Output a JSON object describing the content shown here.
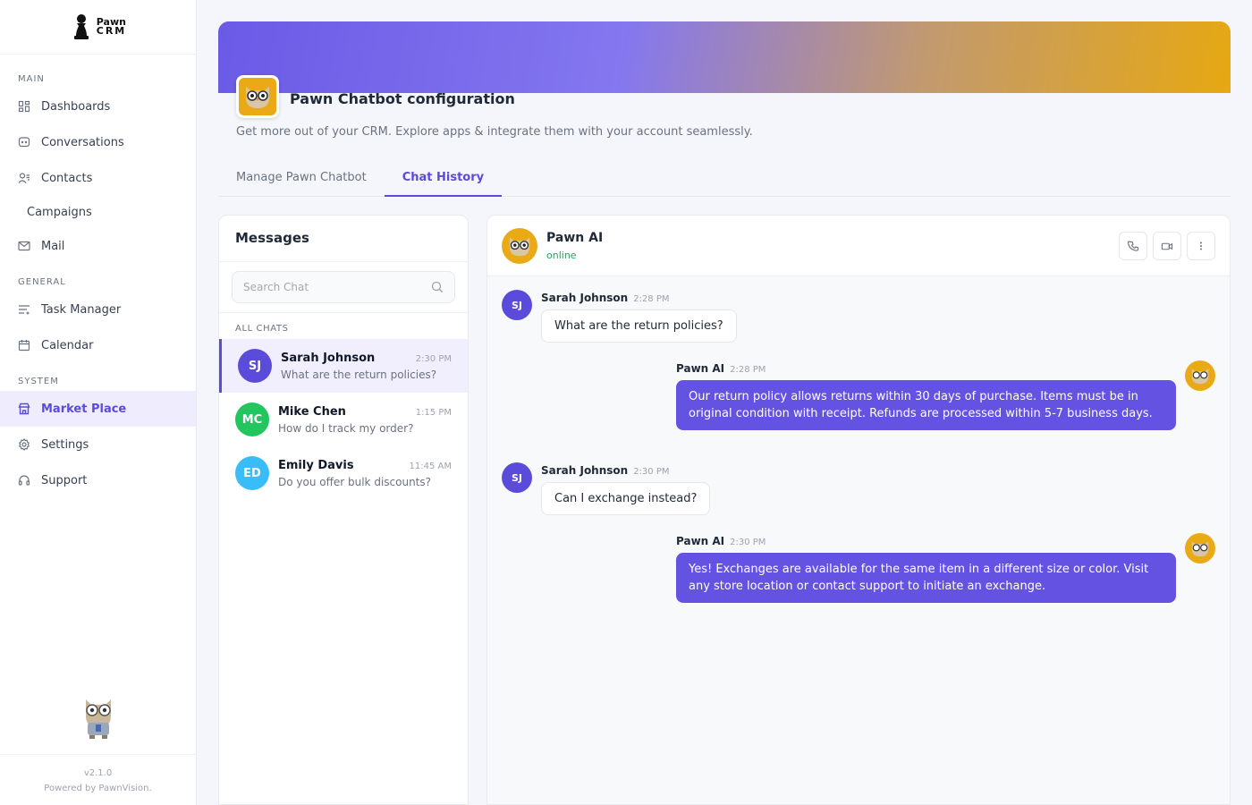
{
  "brand": {
    "line1": "Pawn",
    "line2": "CRM"
  },
  "sidebar": {
    "sections": {
      "main": "MAIN",
      "general": "GENERAL",
      "system": "SYSTEM"
    },
    "items": [
      {
        "label": "Dashboards",
        "icon": "grid-icon"
      },
      {
        "label": "Conversations",
        "icon": "chat-icon"
      },
      {
        "label": "Contacts",
        "icon": "contacts-icon"
      },
      {
        "label": "Campaigns",
        "icon": ""
      },
      {
        "label": "Mail",
        "icon": "mail-icon"
      },
      {
        "label": "Task Manager",
        "icon": "tasks-icon"
      },
      {
        "label": "Calendar",
        "icon": "calendar-icon"
      },
      {
        "label": "Market Place",
        "icon": "store-icon",
        "active": true
      },
      {
        "label": "Settings",
        "icon": "gear-icon"
      },
      {
        "label": "Support",
        "icon": "headset-icon"
      }
    ],
    "version": "v2.1.0",
    "powered_by": "Powered by PawnVision."
  },
  "page": {
    "title": "Pawn Chatbot configuration",
    "subtitle": "Get more out of your CRM. Explore apps & integrate them with your account seamlessly.",
    "tabs": [
      {
        "label": "Manage Pawn Chatbot",
        "active": false
      },
      {
        "label": "Chat History",
        "active": true
      }
    ]
  },
  "messages_panel": {
    "title": "Messages",
    "search_placeholder": "Search Chat",
    "section_label": "ALL CHATS",
    "chats": [
      {
        "initials": "SJ",
        "name": "Sarah Johnson",
        "time": "2:30 PM",
        "preview": "What are the return policies?",
        "color": "#5b4bdb",
        "active": true
      },
      {
        "initials": "MC",
        "name": "Mike Chen",
        "time": "1:15 PM",
        "preview": "How do I track my order?",
        "color": "#22c55e",
        "active": false
      },
      {
        "initials": "ED",
        "name": "Emily Davis",
        "time": "11:45 AM",
        "preview": "Do you offer bulk discounts?",
        "color": "#38bdf8",
        "active": false
      }
    ]
  },
  "conversation": {
    "name": "Pawn AI",
    "status": "online",
    "messages": [
      {
        "sender": "Sarah Johnson",
        "initials": "SJ",
        "time": "2:28 PM",
        "text": "What are the return policies?",
        "from_ai": false
      },
      {
        "sender": "Pawn AI",
        "time": "2:28 PM",
        "text": "Our return policy allows returns within 30 days of purchase. Items must be in original condition with receipt. Refunds are processed within 5-7 business days.",
        "from_ai": true
      },
      {
        "sender": "Sarah Johnson",
        "initials": "SJ",
        "time": "2:30 PM",
        "text": "Can I exchange instead?",
        "from_ai": false
      },
      {
        "sender": "Pawn AI",
        "time": "2:30 PM",
        "text": "Yes! Exchanges are available for the same item in a different size or color. Visit any store location or contact support to initiate an exchange.",
        "from_ai": true
      }
    ]
  },
  "colors": {
    "accent": "#5b4bdb",
    "bubble_ai": "#6452e3",
    "owl": "#e9aa16",
    "online": "#22a55b"
  }
}
